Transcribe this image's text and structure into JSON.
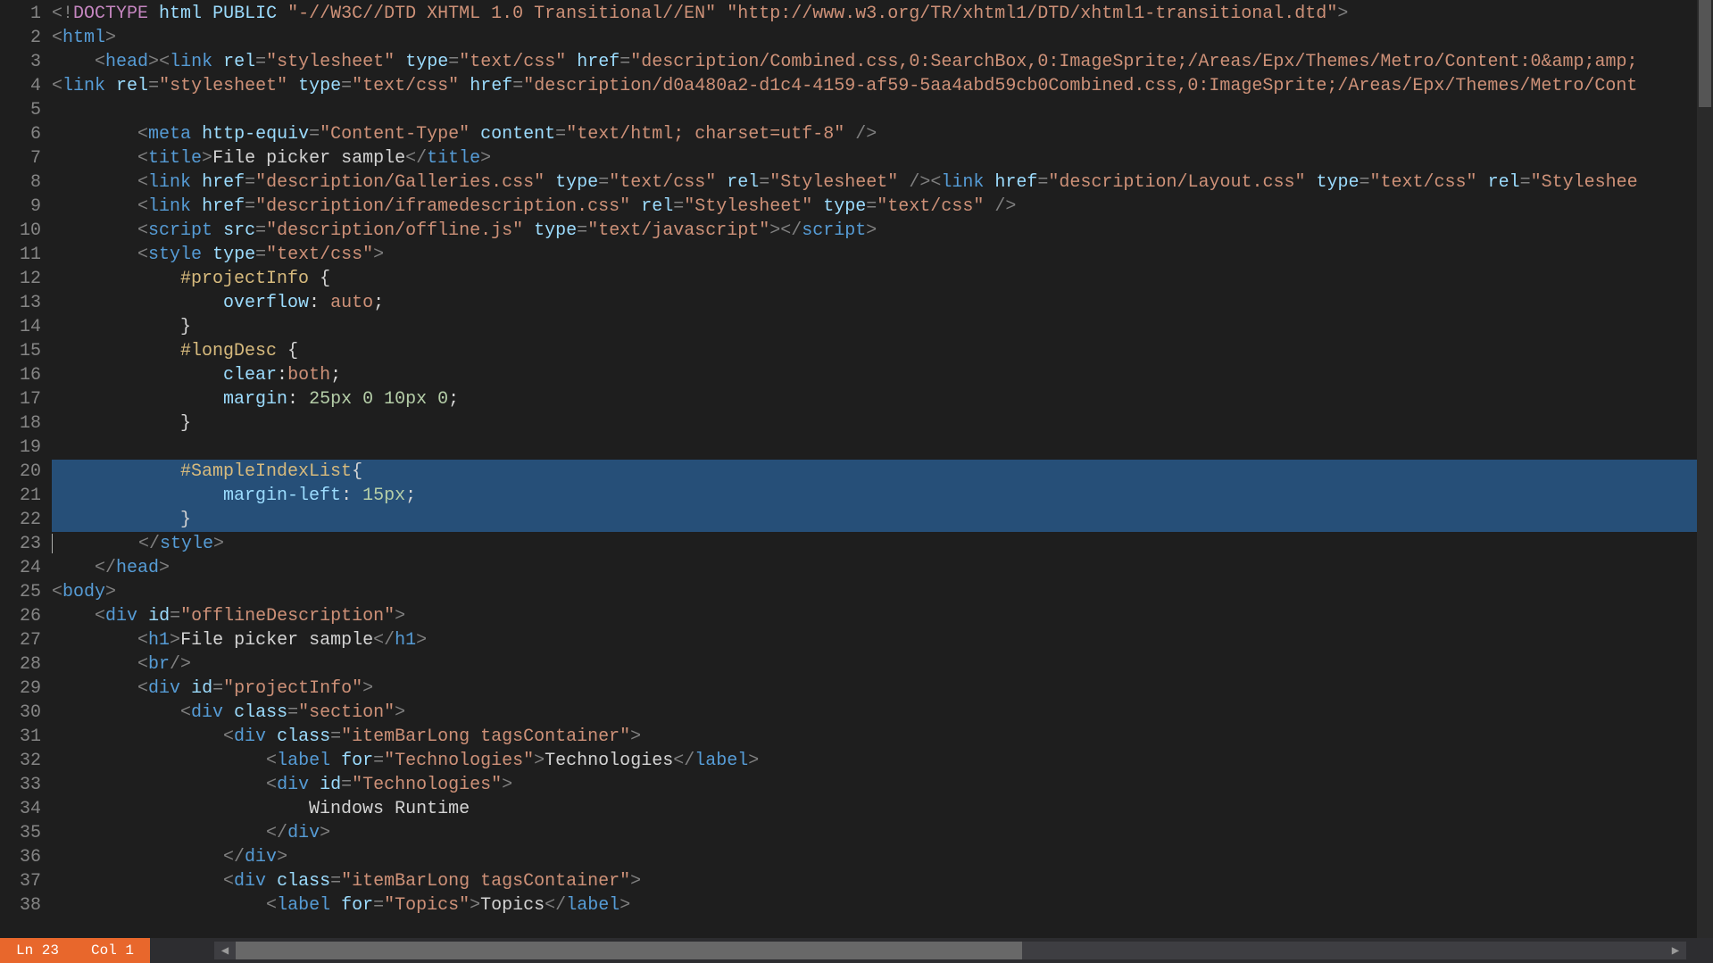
{
  "status": {
    "line_label": "Ln 23",
    "col_label": "Col 1"
  },
  "scroll": {
    "left_arrow": "◀",
    "right_arrow": "▶"
  },
  "code": {
    "first_line": 1,
    "selected_from": 20,
    "selected_to": 22,
    "cursor_line": 23,
    "lines": [
      [
        {
          "c": "pnc",
          "t": "<!"
        },
        {
          "c": "kw",
          "t": "DOCTYPE"
        },
        {
          "c": "txt",
          "t": " "
        },
        {
          "c": "attr",
          "t": "html"
        },
        {
          "c": "txt",
          "t": " "
        },
        {
          "c": "attr",
          "t": "PUBLIC"
        },
        {
          "c": "txt",
          "t": " "
        },
        {
          "c": "str",
          "t": "\"-//W3C//DTD XHTML 1.0 Transitional//EN\""
        },
        {
          "c": "txt",
          "t": " "
        },
        {
          "c": "str",
          "t": "\"http://www.w3.org/TR/xhtml1/DTD/xhtml1-transitional.dtd\""
        },
        {
          "c": "pnc",
          "t": ">"
        }
      ],
      [
        {
          "c": "pnc",
          "t": "<"
        },
        {
          "c": "tag",
          "t": "html"
        },
        {
          "c": "pnc",
          "t": ">"
        }
      ],
      [
        {
          "c": "txt",
          "t": "    "
        },
        {
          "c": "pnc",
          "t": "<"
        },
        {
          "c": "tag",
          "t": "head"
        },
        {
          "c": "pnc",
          "t": ">"
        },
        {
          "c": "pnc",
          "t": "<"
        },
        {
          "c": "tag",
          "t": "link"
        },
        {
          "c": "txt",
          "t": " "
        },
        {
          "c": "attr",
          "t": "rel"
        },
        {
          "c": "pnc",
          "t": "="
        },
        {
          "c": "str",
          "t": "\"stylesheet\""
        },
        {
          "c": "txt",
          "t": " "
        },
        {
          "c": "attr",
          "t": "type"
        },
        {
          "c": "pnc",
          "t": "="
        },
        {
          "c": "str",
          "t": "\"text/css\""
        },
        {
          "c": "txt",
          "t": " "
        },
        {
          "c": "attr",
          "t": "href"
        },
        {
          "c": "pnc",
          "t": "="
        },
        {
          "c": "str",
          "t": "\"description/Combined.css,0:SearchBox,0:ImageSprite;/Areas/Epx/Themes/Metro/Content:0&amp;amp;"
        }
      ],
      [
        {
          "c": "pnc",
          "t": "<"
        },
        {
          "c": "tag",
          "t": "link"
        },
        {
          "c": "txt",
          "t": " "
        },
        {
          "c": "attr",
          "t": "rel"
        },
        {
          "c": "pnc",
          "t": "="
        },
        {
          "c": "str",
          "t": "\"stylesheet\""
        },
        {
          "c": "txt",
          "t": " "
        },
        {
          "c": "attr",
          "t": "type"
        },
        {
          "c": "pnc",
          "t": "="
        },
        {
          "c": "str",
          "t": "\"text/css\""
        },
        {
          "c": "txt",
          "t": " "
        },
        {
          "c": "attr",
          "t": "href"
        },
        {
          "c": "pnc",
          "t": "="
        },
        {
          "c": "str",
          "t": "\"description/d0a480a2-d1c4-4159-af59-5aa4abd59cb0Combined.css,0:ImageSprite;/Areas/Epx/Themes/Metro/Cont"
        }
      ],
      [
        {
          "c": "txt",
          "t": ""
        }
      ],
      [
        {
          "c": "txt",
          "t": "        "
        },
        {
          "c": "pnc",
          "t": "<"
        },
        {
          "c": "tag",
          "t": "meta"
        },
        {
          "c": "txt",
          "t": " "
        },
        {
          "c": "attr",
          "t": "http-equiv"
        },
        {
          "c": "pnc",
          "t": "="
        },
        {
          "c": "str",
          "t": "\"Content-Type\""
        },
        {
          "c": "txt",
          "t": " "
        },
        {
          "c": "attr",
          "t": "content"
        },
        {
          "c": "pnc",
          "t": "="
        },
        {
          "c": "str",
          "t": "\"text/html; charset=utf-8\""
        },
        {
          "c": "txt",
          "t": " "
        },
        {
          "c": "pnc",
          "t": "/>"
        }
      ],
      [
        {
          "c": "txt",
          "t": "        "
        },
        {
          "c": "pnc",
          "t": "<"
        },
        {
          "c": "tag",
          "t": "title"
        },
        {
          "c": "pnc",
          "t": ">"
        },
        {
          "c": "txt",
          "t": "File picker sample"
        },
        {
          "c": "pnc",
          "t": "</"
        },
        {
          "c": "tag",
          "t": "title"
        },
        {
          "c": "pnc",
          "t": ">"
        }
      ],
      [
        {
          "c": "txt",
          "t": "        "
        },
        {
          "c": "pnc",
          "t": "<"
        },
        {
          "c": "tag",
          "t": "link"
        },
        {
          "c": "txt",
          "t": " "
        },
        {
          "c": "attr",
          "t": "href"
        },
        {
          "c": "pnc",
          "t": "="
        },
        {
          "c": "str",
          "t": "\"description/Galleries.css\""
        },
        {
          "c": "txt",
          "t": " "
        },
        {
          "c": "attr",
          "t": "type"
        },
        {
          "c": "pnc",
          "t": "="
        },
        {
          "c": "str",
          "t": "\"text/css\""
        },
        {
          "c": "txt",
          "t": " "
        },
        {
          "c": "attr",
          "t": "rel"
        },
        {
          "c": "pnc",
          "t": "="
        },
        {
          "c": "str",
          "t": "\"Stylesheet\""
        },
        {
          "c": "txt",
          "t": " "
        },
        {
          "c": "pnc",
          "t": "/>"
        },
        {
          "c": "pnc",
          "t": "<"
        },
        {
          "c": "tag",
          "t": "link"
        },
        {
          "c": "txt",
          "t": " "
        },
        {
          "c": "attr",
          "t": "href"
        },
        {
          "c": "pnc",
          "t": "="
        },
        {
          "c": "str",
          "t": "\"description/Layout.css\""
        },
        {
          "c": "txt",
          "t": " "
        },
        {
          "c": "attr",
          "t": "type"
        },
        {
          "c": "pnc",
          "t": "="
        },
        {
          "c": "str",
          "t": "\"text/css\""
        },
        {
          "c": "txt",
          "t": " "
        },
        {
          "c": "attr",
          "t": "rel"
        },
        {
          "c": "pnc",
          "t": "="
        },
        {
          "c": "str",
          "t": "\"Styleshee"
        }
      ],
      [
        {
          "c": "txt",
          "t": "        "
        },
        {
          "c": "pnc",
          "t": "<"
        },
        {
          "c": "tag",
          "t": "link"
        },
        {
          "c": "txt",
          "t": " "
        },
        {
          "c": "attr",
          "t": "href"
        },
        {
          "c": "pnc",
          "t": "="
        },
        {
          "c": "str",
          "t": "\"description/iframedescription.css\""
        },
        {
          "c": "txt",
          "t": " "
        },
        {
          "c": "attr",
          "t": "rel"
        },
        {
          "c": "pnc",
          "t": "="
        },
        {
          "c": "str",
          "t": "\"Stylesheet\""
        },
        {
          "c": "txt",
          "t": " "
        },
        {
          "c": "attr",
          "t": "type"
        },
        {
          "c": "pnc",
          "t": "="
        },
        {
          "c": "str",
          "t": "\"text/css\""
        },
        {
          "c": "txt",
          "t": " "
        },
        {
          "c": "pnc",
          "t": "/>"
        }
      ],
      [
        {
          "c": "txt",
          "t": "        "
        },
        {
          "c": "pnc",
          "t": "<"
        },
        {
          "c": "tag",
          "t": "script"
        },
        {
          "c": "txt",
          "t": " "
        },
        {
          "c": "attr",
          "t": "src"
        },
        {
          "c": "pnc",
          "t": "="
        },
        {
          "c": "str",
          "t": "\"description/offline.js\""
        },
        {
          "c": "txt",
          "t": " "
        },
        {
          "c": "attr",
          "t": "type"
        },
        {
          "c": "pnc",
          "t": "="
        },
        {
          "c": "str",
          "t": "\"text/javascript\""
        },
        {
          "c": "pnc",
          "t": ">"
        },
        {
          "c": "pnc",
          "t": "</"
        },
        {
          "c": "tag",
          "t": "script"
        },
        {
          "c": "pnc",
          "t": ">"
        }
      ],
      [
        {
          "c": "txt",
          "t": "        "
        },
        {
          "c": "pnc",
          "t": "<"
        },
        {
          "c": "tag",
          "t": "style"
        },
        {
          "c": "txt",
          "t": " "
        },
        {
          "c": "attr",
          "t": "type"
        },
        {
          "c": "pnc",
          "t": "="
        },
        {
          "c": "str",
          "t": "\"text/css\""
        },
        {
          "c": "pnc",
          "t": ">"
        }
      ],
      [
        {
          "c": "txt",
          "t": "            "
        },
        {
          "c": "sel",
          "t": "#projectInfo"
        },
        {
          "c": "txt",
          "t": " {"
        }
      ],
      [
        {
          "c": "txt",
          "t": "                "
        },
        {
          "c": "prop",
          "t": "overflow"
        },
        {
          "c": "txt",
          "t": ": "
        },
        {
          "c": "val",
          "t": "auto"
        },
        {
          "c": "txt",
          "t": ";"
        }
      ],
      [
        {
          "c": "txt",
          "t": "            }"
        }
      ],
      [
        {
          "c": "txt",
          "t": "            "
        },
        {
          "c": "sel",
          "t": "#longDesc"
        },
        {
          "c": "txt",
          "t": " {"
        }
      ],
      [
        {
          "c": "txt",
          "t": "                "
        },
        {
          "c": "prop",
          "t": "clear"
        },
        {
          "c": "txt",
          "t": ":"
        },
        {
          "c": "val",
          "t": "both"
        },
        {
          "c": "txt",
          "t": ";"
        }
      ],
      [
        {
          "c": "txt",
          "t": "                "
        },
        {
          "c": "prop",
          "t": "margin"
        },
        {
          "c": "txt",
          "t": ": "
        },
        {
          "c": "num",
          "t": "25px"
        },
        {
          "c": "txt",
          "t": " "
        },
        {
          "c": "num",
          "t": "0"
        },
        {
          "c": "txt",
          "t": " "
        },
        {
          "c": "num",
          "t": "10px"
        },
        {
          "c": "txt",
          "t": " "
        },
        {
          "c": "num",
          "t": "0"
        },
        {
          "c": "txt",
          "t": ";"
        }
      ],
      [
        {
          "c": "txt",
          "t": "            }"
        }
      ],
      [
        {
          "c": "txt",
          "t": ""
        }
      ],
      [
        {
          "c": "txt",
          "t": "            "
        },
        {
          "c": "sel",
          "t": "#SampleIndexList"
        },
        {
          "c": "txt",
          "t": "{"
        }
      ],
      [
        {
          "c": "txt",
          "t": "                "
        },
        {
          "c": "prop",
          "t": "margin-left"
        },
        {
          "c": "txt",
          "t": ": "
        },
        {
          "c": "num",
          "t": "15px"
        },
        {
          "c": "txt",
          "t": ";"
        }
      ],
      [
        {
          "c": "txt",
          "t": "            }"
        }
      ],
      [
        {
          "c": "txt",
          "t": "        "
        },
        {
          "c": "pnc",
          "t": "</"
        },
        {
          "c": "tag",
          "t": "style"
        },
        {
          "c": "pnc",
          "t": ">"
        }
      ],
      [
        {
          "c": "txt",
          "t": "    "
        },
        {
          "c": "pnc",
          "t": "</"
        },
        {
          "c": "tag",
          "t": "head"
        },
        {
          "c": "pnc",
          "t": ">"
        }
      ],
      [
        {
          "c": "pnc",
          "t": "<"
        },
        {
          "c": "tag",
          "t": "body"
        },
        {
          "c": "pnc",
          "t": ">"
        }
      ],
      [
        {
          "c": "txt",
          "t": "    "
        },
        {
          "c": "pnc",
          "t": "<"
        },
        {
          "c": "tag",
          "t": "div"
        },
        {
          "c": "txt",
          "t": " "
        },
        {
          "c": "attr",
          "t": "id"
        },
        {
          "c": "pnc",
          "t": "="
        },
        {
          "c": "str",
          "t": "\"offlineDescription\""
        },
        {
          "c": "pnc",
          "t": ">"
        }
      ],
      [
        {
          "c": "txt",
          "t": "        "
        },
        {
          "c": "pnc",
          "t": "<"
        },
        {
          "c": "tag",
          "t": "h1"
        },
        {
          "c": "pnc",
          "t": ">"
        },
        {
          "c": "txt",
          "t": "File picker sample"
        },
        {
          "c": "pnc",
          "t": "</"
        },
        {
          "c": "tag",
          "t": "h1"
        },
        {
          "c": "pnc",
          "t": ">"
        }
      ],
      [
        {
          "c": "txt",
          "t": "        "
        },
        {
          "c": "pnc",
          "t": "<"
        },
        {
          "c": "tag",
          "t": "br"
        },
        {
          "c": "pnc",
          "t": "/>"
        }
      ],
      [
        {
          "c": "txt",
          "t": "        "
        },
        {
          "c": "pnc",
          "t": "<"
        },
        {
          "c": "tag",
          "t": "div"
        },
        {
          "c": "txt",
          "t": " "
        },
        {
          "c": "attr",
          "t": "id"
        },
        {
          "c": "pnc",
          "t": "="
        },
        {
          "c": "str",
          "t": "\"projectInfo\""
        },
        {
          "c": "pnc",
          "t": ">"
        }
      ],
      [
        {
          "c": "txt",
          "t": "            "
        },
        {
          "c": "pnc",
          "t": "<"
        },
        {
          "c": "tag",
          "t": "div"
        },
        {
          "c": "txt",
          "t": " "
        },
        {
          "c": "attr",
          "t": "class"
        },
        {
          "c": "pnc",
          "t": "="
        },
        {
          "c": "str",
          "t": "\"section\""
        },
        {
          "c": "pnc",
          "t": ">"
        }
      ],
      [
        {
          "c": "txt",
          "t": "                "
        },
        {
          "c": "pnc",
          "t": "<"
        },
        {
          "c": "tag",
          "t": "div"
        },
        {
          "c": "txt",
          "t": " "
        },
        {
          "c": "attr",
          "t": "class"
        },
        {
          "c": "pnc",
          "t": "="
        },
        {
          "c": "str",
          "t": "\"itemBarLong tagsContainer\""
        },
        {
          "c": "pnc",
          "t": ">"
        }
      ],
      [
        {
          "c": "txt",
          "t": "                    "
        },
        {
          "c": "pnc",
          "t": "<"
        },
        {
          "c": "tag",
          "t": "label"
        },
        {
          "c": "txt",
          "t": " "
        },
        {
          "c": "attr",
          "t": "for"
        },
        {
          "c": "pnc",
          "t": "="
        },
        {
          "c": "str",
          "t": "\"Technologies\""
        },
        {
          "c": "pnc",
          "t": ">"
        },
        {
          "c": "txt",
          "t": "Technologies"
        },
        {
          "c": "pnc",
          "t": "</"
        },
        {
          "c": "tag",
          "t": "label"
        },
        {
          "c": "pnc",
          "t": ">"
        }
      ],
      [
        {
          "c": "txt",
          "t": "                    "
        },
        {
          "c": "pnc",
          "t": "<"
        },
        {
          "c": "tag",
          "t": "div"
        },
        {
          "c": "txt",
          "t": " "
        },
        {
          "c": "attr",
          "t": "id"
        },
        {
          "c": "pnc",
          "t": "="
        },
        {
          "c": "str",
          "t": "\"Technologies\""
        },
        {
          "c": "pnc",
          "t": ">"
        }
      ],
      [
        {
          "c": "txt",
          "t": "                        Windows Runtime"
        }
      ],
      [
        {
          "c": "txt",
          "t": "                    "
        },
        {
          "c": "pnc",
          "t": "</"
        },
        {
          "c": "tag",
          "t": "div"
        },
        {
          "c": "pnc",
          "t": ">"
        }
      ],
      [
        {
          "c": "txt",
          "t": "                "
        },
        {
          "c": "pnc",
          "t": "</"
        },
        {
          "c": "tag",
          "t": "div"
        },
        {
          "c": "pnc",
          "t": ">"
        }
      ],
      [
        {
          "c": "txt",
          "t": "                "
        },
        {
          "c": "pnc",
          "t": "<"
        },
        {
          "c": "tag",
          "t": "div"
        },
        {
          "c": "txt",
          "t": " "
        },
        {
          "c": "attr",
          "t": "class"
        },
        {
          "c": "pnc",
          "t": "="
        },
        {
          "c": "str",
          "t": "\"itemBarLong tagsContainer\""
        },
        {
          "c": "pnc",
          "t": ">"
        }
      ],
      [
        {
          "c": "txt",
          "t": "                    "
        },
        {
          "c": "pnc",
          "t": "<"
        },
        {
          "c": "tag",
          "t": "label"
        },
        {
          "c": "txt",
          "t": " "
        },
        {
          "c": "attr",
          "t": "for"
        },
        {
          "c": "pnc",
          "t": "="
        },
        {
          "c": "str",
          "t": "\"Topics\""
        },
        {
          "c": "pnc",
          "t": ">"
        },
        {
          "c": "txt",
          "t": "Topics"
        },
        {
          "c": "pnc",
          "t": "</"
        },
        {
          "c": "tag",
          "t": "label"
        },
        {
          "c": "pnc",
          "t": ">"
        }
      ]
    ]
  }
}
